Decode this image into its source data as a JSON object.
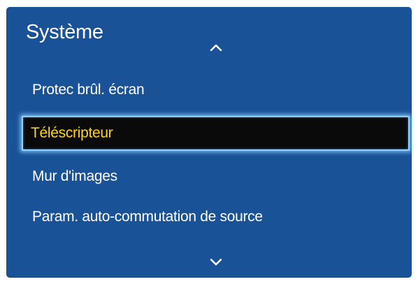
{
  "menu": {
    "title": "Système",
    "items": [
      {
        "label": "Protec brûl. écran",
        "selected": false
      },
      {
        "label": "Téléscripteur",
        "selected": true
      },
      {
        "label": "Mur d'images",
        "selected": false
      },
      {
        "label": "Param. auto-commutation de source",
        "selected": false
      }
    ],
    "scroll_up_icon": "chevron-up-icon",
    "scroll_down_icon": "chevron-down-icon"
  },
  "colors": {
    "panel_background": "#1a5297",
    "text": "#ffffff",
    "selected_background": "#0a0a0a",
    "selected_text": "#ffd21a",
    "selected_border": "#8fd0ff"
  }
}
